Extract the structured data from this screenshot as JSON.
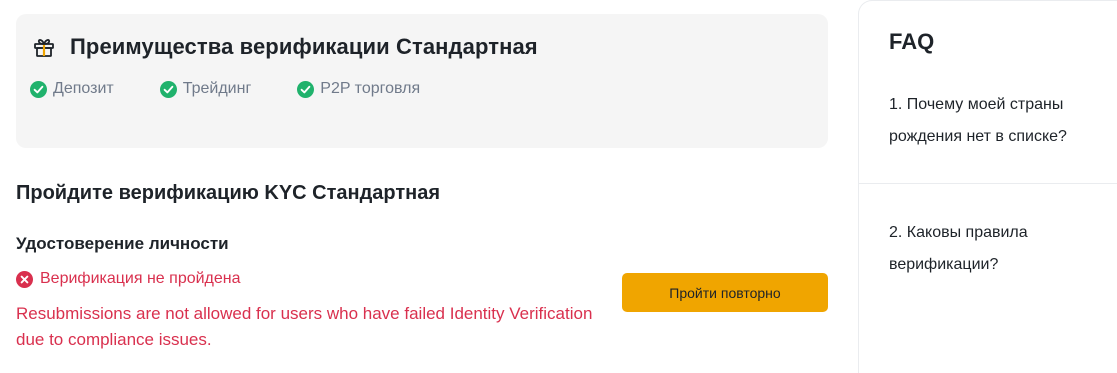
{
  "benefits": {
    "title": "Преимущества верификации Стандартная",
    "items": [
      {
        "label": "Депозит",
        "icon": "check-circle-icon"
      },
      {
        "label": "Трейдинг",
        "icon": "check-circle-icon"
      },
      {
        "label": "P2P торговля",
        "icon": "check-circle-icon"
      }
    ],
    "title_icon": "gift-icon"
  },
  "kyc": {
    "title": "Пройдите верификацию KYC Стандартная",
    "identity": {
      "title": "Удостоверение личности",
      "status": "Верификация не пройдена",
      "status_icon": "error-circle-icon",
      "error_message": "Resubmissions are not allowed for users who have failed Identity Verification due to compliance issues.",
      "retry_label": "Пройти повторно"
    }
  },
  "faq": {
    "title": "FAQ",
    "items": [
      {
        "question": "1. Почему моей страны рождения нет в списке?"
      },
      {
        "question": "2. Каковы правила верификации?"
      }
    ]
  },
  "colors": {
    "accent": "#f0a500",
    "success": "#20b26c",
    "error": "#d9304e",
    "card_bg": "#f5f5f5"
  }
}
